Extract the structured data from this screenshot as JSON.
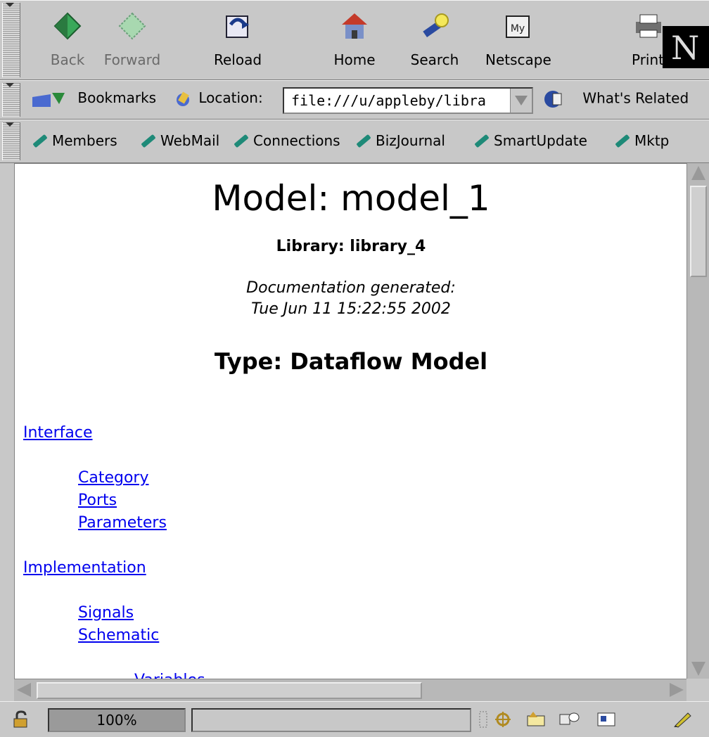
{
  "nav": {
    "back": "Back",
    "forward": "Forward",
    "reload": "Reload",
    "home": "Home",
    "search": "Search",
    "netscape": "Netscape",
    "print": "Print",
    "netscape_icon_text": "My",
    "logo_letter": "N"
  },
  "location_bar": {
    "bookmarks": "Bookmarks",
    "location_label": "Location:",
    "url": "file:///u/appleby/libra",
    "whats_related": "What's Related"
  },
  "personal_toolbar": {
    "items": [
      "Members",
      "WebMail",
      "Connections",
      "BizJournal",
      "SmartUpdate",
      "Mktp"
    ]
  },
  "page": {
    "title": "Model: model_1",
    "library": "Library: library_4",
    "doc_generated_label": "Documentation generated:",
    "doc_generated_date": "Tue Jun 11 15:22:55 2002",
    "type": "Type: Dataflow Model",
    "links": {
      "interface": "Interface",
      "category": "Category",
      "ports": "Ports",
      "parameters": "Parameters",
      "implementation": "Implementation",
      "signals": "Signals",
      "schematic": "Schematic",
      "variables": "Variables"
    }
  },
  "status": {
    "zoom": "100%"
  }
}
